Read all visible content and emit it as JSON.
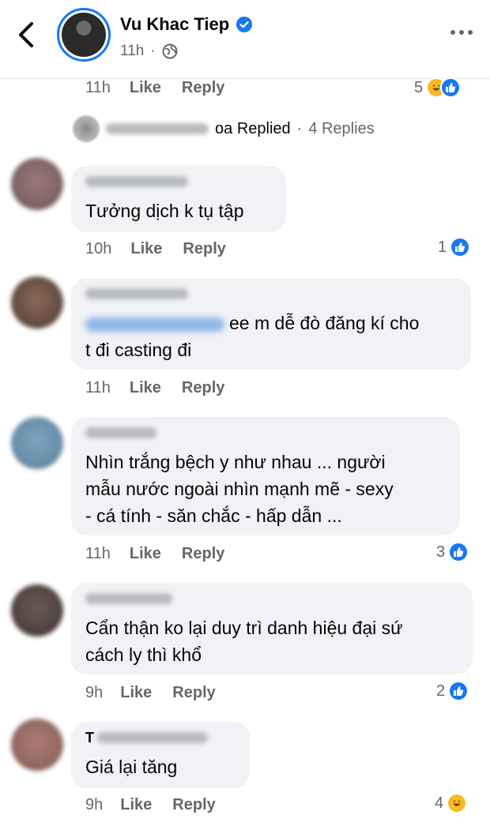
{
  "header": {
    "title": "Vu Khac Tiep",
    "time": "11h",
    "accent": "#1877f2",
    "icons": [
      "back-chevron-icon",
      "verified-badge-icon",
      "globe-icon",
      "more-options-icon"
    ]
  },
  "top_actions": {
    "time": "11h",
    "like": "Like",
    "reply": "Reply",
    "count": "5"
  },
  "replied": {
    "name_suffix": "oa",
    "replied": "Replied",
    "sep": "·",
    "replies": "4 Replies"
  },
  "comments": [
    {
      "time": "10h",
      "like": "Like",
      "reply": "Reply",
      "count": "1",
      "text": "Tưởng dịch k tụ tập"
    },
    {
      "time": "11h",
      "like": "Like",
      "reply": "Reply",
      "text_line1": "ee m dễ đò đăng kí cho",
      "text_line2": "t đi casting đi"
    },
    {
      "time": "11h",
      "like": "Like",
      "reply": "Reply",
      "count": "3",
      "text_line1": "Nhìn trắng bệch y như nhau ... người",
      "text_line2": "mẫu nước ngoài nhìn mạnh mẽ - sexy",
      "text_line3": "- cá tính - săn chắc - hấp dẫn ..."
    },
    {
      "time": "9h",
      "like": "Like",
      "reply": "Reply",
      "count": "2",
      "text_line1": "Cẩn thận ko lại duy trì danh hiệu đại sứ",
      "text_line2": "cách ly thì khổ"
    },
    {
      "time": "9h",
      "like": "Like",
      "reply": "Reply",
      "count": "4",
      "author_initial": "T",
      "text": "Giá lại tăng"
    }
  ]
}
